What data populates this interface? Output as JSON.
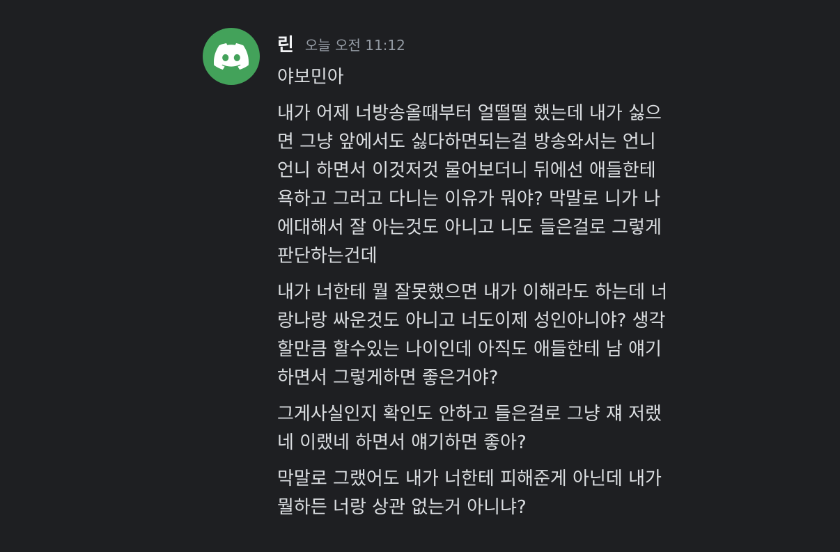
{
  "message": {
    "author": "린",
    "timestamp": "오늘 오전 11:12",
    "avatar_color": "#43a25a",
    "avatar_icon": "discord-logo-icon",
    "blocks": [
      [
        "야보민아"
      ],
      [
        "내가 어제 너방송올때부터 얼떨떨 했는데 내가 싫으",
        "면 그냥 앞에서도 싫다하면되는걸 방송와서는 언니",
        "언니 하면서 이것저것 물어보더니 뒤에선 애들한테",
        "욕하고 그러고 다니는 이유가 뭐야? 막말로 니가 나",
        "에대해서 잘 아는것도 아니고 니도 들은걸로 그렇게",
        "판단하는건데"
      ],
      [
        "내가 너한테 뭘 잘못했으면 내가 이해라도 하는데 너",
        "랑나랑 싸운것도 아니고 너도이제 성인아니야? 생각",
        "할만큼 할수있는 나이인데 아직도 애들한테 남 얘기",
        "하면서 그렇게하면 좋은거야?"
      ],
      [
        "그게사실인지 확인도 안하고 들은걸로 그냥 쟤 저랬",
        "네 이랬네 하면서 얘기하면 좋아?"
      ],
      [
        "막말로 그랬어도 내가 너한테 피해준게 아닌데 내가",
        "뭘하든 너랑 상관 없는거 아니냐?"
      ]
    ]
  }
}
